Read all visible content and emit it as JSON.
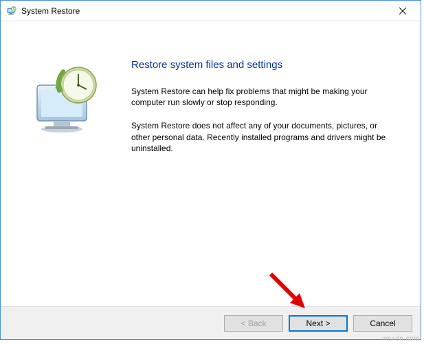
{
  "titlebar": {
    "title": "System Restore",
    "close_label": "Close"
  },
  "content": {
    "heading": "Restore system files and settings",
    "paragraph1": "System Restore can help fix problems that might be making your computer run slowly or stop responding.",
    "paragraph2": "System Restore does not affect any of your documents, pictures, or other personal data. Recently installed programs and drivers might be uninstalled."
  },
  "buttons": {
    "back": "< Back",
    "next": "Next >",
    "cancel": "Cancel"
  },
  "watermark": "wsxdn.com"
}
